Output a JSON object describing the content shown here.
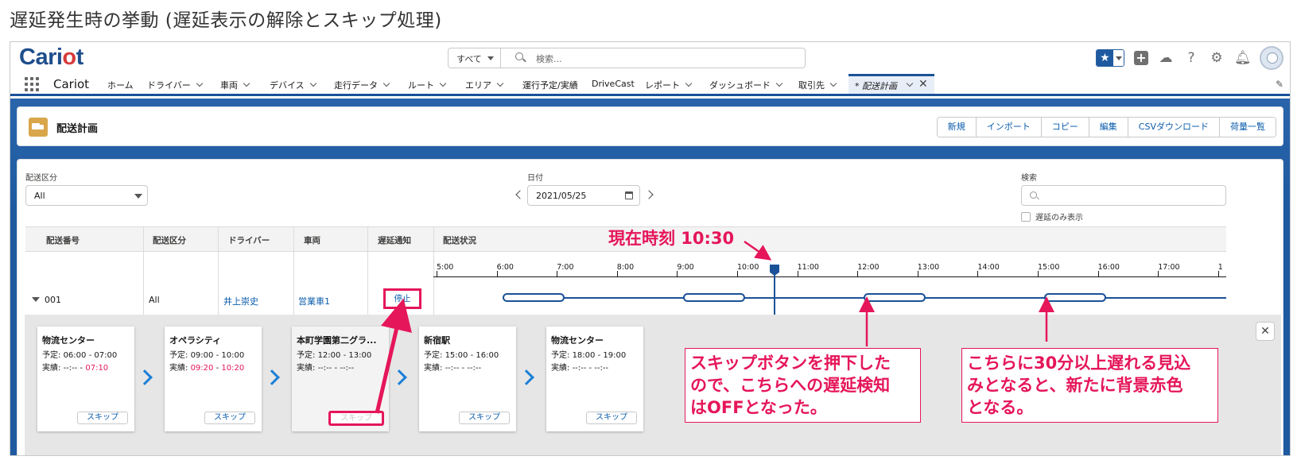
{
  "page_title": "遅延発生時の挙動 (遅延表示の解除とスキップ処理)",
  "header": {
    "logo_main": "Cari",
    "logo_dot": "o",
    "logo_tail": "t",
    "search_scope": "すべて",
    "search_placeholder": "検索..."
  },
  "nav": {
    "app_name": "Cariot",
    "items": [
      "ホーム",
      "ドライバー",
      "車両",
      "デバイス",
      "走行データ",
      "ルート",
      "エリア",
      "運行予定/実績",
      "DriveCast",
      "レポート",
      "ダッシュボード",
      "取引先"
    ],
    "active_tab": "* 配送計画"
  },
  "object": {
    "title": "配送計画",
    "buttons": [
      "新規",
      "インポート",
      "コピー",
      "編集",
      "CSVダウンロード",
      "荷量一覧"
    ]
  },
  "filters": {
    "type_label": "配送区分",
    "type_value": "All",
    "date_label": "日付",
    "date_value": "2021/05/25",
    "search_label": "検索",
    "delay_only_label": "遅延のみ表示"
  },
  "table": {
    "headers": [
      "配送番号",
      "配送区分",
      "ドライバー",
      "車両",
      "遅延通知",
      "配送状況"
    ],
    "row": {
      "number": "001",
      "type": "All",
      "driver": "井上崇史",
      "vehicle": "営業車1",
      "notify_button": "停止"
    },
    "timeline_ticks": [
      "5:00",
      "6:00",
      "7:00",
      "8:00",
      "9:00",
      "10:00",
      "11:00",
      "12:00",
      "13:00",
      "14:00",
      "15:00",
      "16:00",
      "17:00",
      "1"
    ]
  },
  "stops": [
    {
      "name": "物流センター",
      "plan_label": "予定:",
      "plan_start": "06:00",
      "plan_end": "07:00",
      "actual_label": "実績:",
      "actual_start": "--:--",
      "actual_end": "07:10",
      "skip": "スキップ"
    },
    {
      "name": "オペラシティ",
      "plan_label": "予定:",
      "plan_start": "09:00",
      "plan_end": "10:00",
      "actual_label": "実績:",
      "actual_start": "09:20",
      "actual_end": "10:20",
      "skip": "スキップ"
    },
    {
      "name": "本町学園第二グラ...",
      "plan_label": "予定:",
      "plan_start": "12:00",
      "plan_end": "13:00",
      "actual_label": "実績:",
      "actual_start": "--:--",
      "actual_end": "--:--",
      "skip": "スキップ"
    },
    {
      "name": "新宿駅",
      "plan_label": "予定:",
      "plan_start": "15:00",
      "plan_end": "16:00",
      "actual_label": "実績:",
      "actual_start": "--:--",
      "actual_end": "--:--",
      "skip": "スキップ"
    },
    {
      "name": "物流センター",
      "plan_label": "予定:",
      "plan_start": "18:00",
      "plan_end": "19:00",
      "actual_label": "実績:",
      "actual_start": "--:--",
      "actual_end": "--:--",
      "skip": "スキップ"
    }
  ],
  "annotations": {
    "now": "現在時刻 10:30",
    "callout_skip_1": "スキップボタンを押下した",
    "callout_skip_2": "ので、こちらへの遅延検知",
    "callout_skip_3": "はOFFとなった。",
    "callout_late_1": "こちらに30分以上遅れる見込",
    "callout_late_2": "みとなると、新たに背景赤色",
    "callout_late_3": "となる。"
  },
  "colors": {
    "brand": "#1f4e8c",
    "accent_blue": "#1b5297",
    "annotation": "#e5165a",
    "late_text": "#e5165a"
  },
  "icons": [
    "star-icon",
    "plus-icon",
    "cloud-icon",
    "help-icon",
    "gear-icon",
    "bell-icon",
    "avatar-icon",
    "waffle-icon",
    "pencil-icon",
    "calendar-icon",
    "search-icon",
    "close-icon",
    "truck-icon"
  ]
}
